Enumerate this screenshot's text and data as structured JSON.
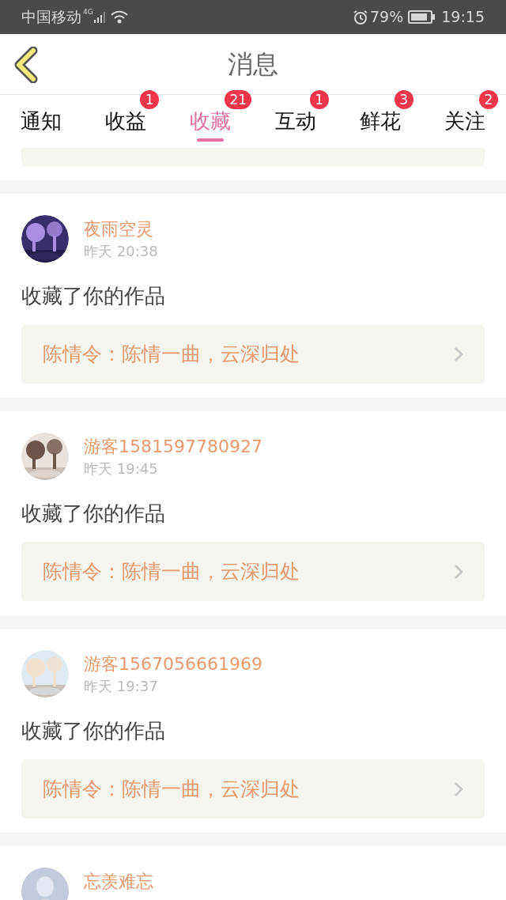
{
  "status_bar": {
    "carrier": "中国移动",
    "network": "4G",
    "battery": "79%",
    "time": "19:15"
  },
  "header": {
    "title": "消息"
  },
  "tabs": [
    {
      "label": "通知",
      "selected": false
    },
    {
      "label": "收益",
      "badge": "1",
      "selected": false
    },
    {
      "label": "收藏",
      "badge": "21",
      "selected": true
    },
    {
      "label": "互动",
      "badge": "1",
      "selected": false
    },
    {
      "label": "鲜花",
      "badge": "3",
      "selected": false
    },
    {
      "label": "关注",
      "badge": "2",
      "selected": false
    }
  ],
  "messages": [
    {
      "kind": "picture",
      "name": "夜雨空灵",
      "time": "昨天 20:38",
      "action": "收藏了你的作品",
      "work": "陈情令：陈情一曲，云深归处"
    },
    {
      "kind": "picture",
      "name": "游客1581597780927",
      "time": "昨天 19:45",
      "action": "收藏了你的作品",
      "work": "陈情令：陈情一曲，云深归处"
    },
    {
      "kind": "picture",
      "name": "游客1567056661969",
      "time": "昨天 19:37",
      "action": "收藏了你的作品",
      "work": "陈情令：陈情一曲，云深归处"
    },
    {
      "kind": "default",
      "name": "忘羡难忘"
    }
  ]
}
